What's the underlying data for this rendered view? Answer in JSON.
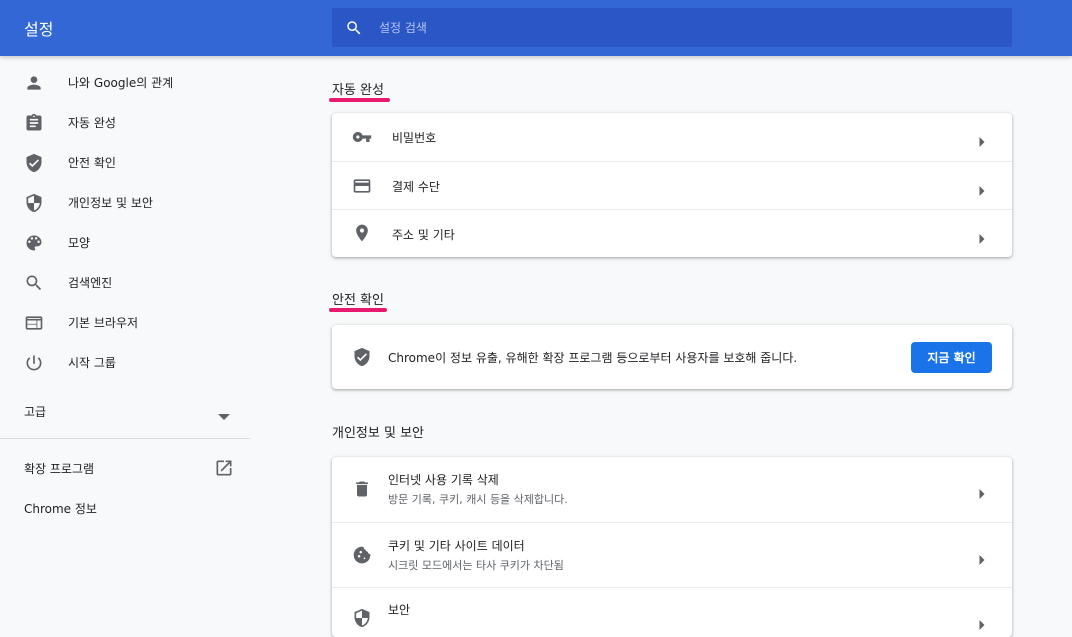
{
  "header": {
    "title": "설정",
    "search_placeholder": "설정 검색"
  },
  "sidebar": {
    "items": [
      {
        "label": "나와 Google의 관계",
        "icon": "person-icon"
      },
      {
        "label": "자동 완성",
        "icon": "clipboard-icon"
      },
      {
        "label": "안전 확인",
        "icon": "shield-check-icon"
      },
      {
        "label": "개인정보 및 보안",
        "icon": "shield-half-icon"
      },
      {
        "label": "모양",
        "icon": "palette-icon"
      },
      {
        "label": "검색엔진",
        "icon": "search-icon"
      },
      {
        "label": "기본 브라우저",
        "icon": "browser-window-icon"
      },
      {
        "label": "시작 그룹",
        "icon": "power-icon"
      }
    ],
    "advanced_label": "고급",
    "extensions_label": "확장 프로그램",
    "about_label": "Chrome 정보"
  },
  "autofill": {
    "title": "자동 완성",
    "rows": [
      {
        "label": "비밀번호",
        "icon": "key-icon"
      },
      {
        "label": "결제 수단",
        "icon": "credit-card-icon"
      },
      {
        "label": "주소 및 기타",
        "icon": "location-pin-icon"
      }
    ]
  },
  "safety_check": {
    "title": "안전 확인",
    "description": "Chrome이 정보 유출, 유해한 확장 프로그램 등으로부터 사용자를 보호해 줍니다.",
    "button_label": "지금 확인"
  },
  "privacy": {
    "title": "개인정보 및 보안",
    "rows": [
      {
        "label": "인터넷 사용 기록 삭제",
        "sub": "방문 기록, 쿠키, 캐시 등을 삭제합니다.",
        "icon": "trash-icon"
      },
      {
        "label": "쿠키 및 기타 사이트 데이터",
        "sub": "시크릿 모드에서는 타사 쿠키가 차단됨",
        "icon": "cookie-icon"
      },
      {
        "label": "보안",
        "icon": "shield-half-icon"
      }
    ]
  },
  "colors": {
    "header": "#3367d6",
    "search_bg": "#2a56c6",
    "accent": "#1a73e8",
    "highlight": "#e8196e",
    "icon": "#5f6368"
  }
}
